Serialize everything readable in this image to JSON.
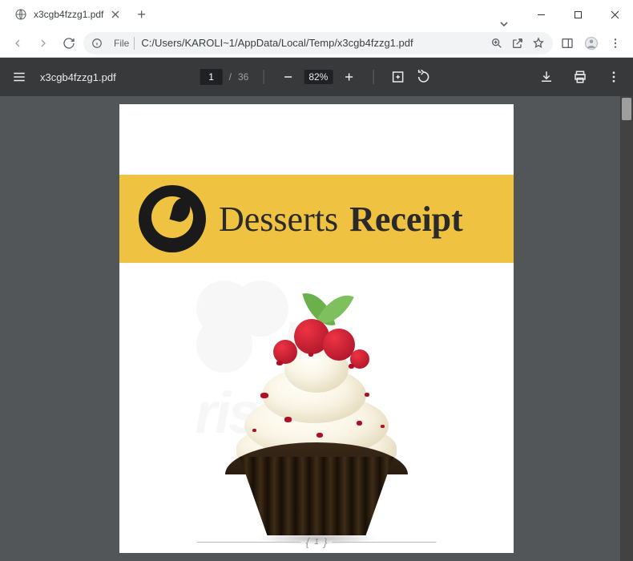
{
  "browser": {
    "tab_title": "x3cgb4fzzg1.pdf",
    "file_label": "File",
    "url": "C:/Users/KAROLI~1/AppData/Local/Temp/x3cgb4fzzg1.pdf"
  },
  "pdf_toolbar": {
    "filename": "x3cgb4fzzg1.pdf",
    "current_page": "1",
    "page_sep": "/",
    "total_pages": "36",
    "zoom_pct": "82%"
  },
  "document": {
    "banner_word1": "Desserts",
    "banner_word2": "Receipt",
    "page_number": "1",
    "watermark_top": "pc",
    "watermark_bottom": "risk"
  },
  "colors": {
    "banner_bg": "#f0c242",
    "pdf_toolbar_bg": "#38393b",
    "viewer_bg": "#525659"
  }
}
